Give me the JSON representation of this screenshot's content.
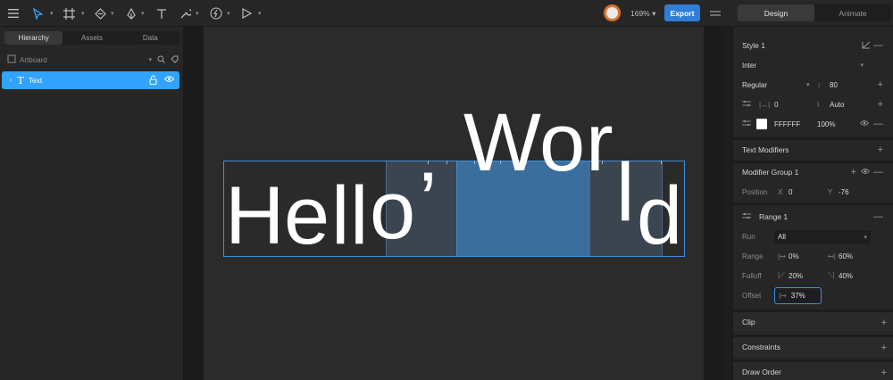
{
  "toolbar": {
    "zoom": "169%",
    "export_label": "Export",
    "mode_tabs": [
      "Design",
      "Animate"
    ]
  },
  "left_panel": {
    "tabs": [
      "Hierarchy",
      "Assets",
      "Data"
    ],
    "artboard_label": "Artboard",
    "layer_name": "Text"
  },
  "canvas": {
    "glyphs": {
      "H": "H",
      "e": "e",
      "l1": "l",
      "l2": "l",
      "o": "o",
      "comma": "’",
      "W": "W",
      "o2": "o",
      "r": "r",
      "l3": "l",
      "d": "d"
    }
  },
  "right_panel": {
    "style_name": "Style 1",
    "font_family": "Inter",
    "font_weight": "Regular",
    "font_size": "80",
    "letter_spacing": "0",
    "line_height": "Auto",
    "fill_hex": "FFFFFF",
    "fill_opacity": "100%",
    "text_modifiers": "Text Modifiers",
    "modifier_group": "Modifier Group 1",
    "position_label": "Position",
    "pos_x_label": "X",
    "pos_x": "0",
    "pos_y_label": "Y",
    "pos_y": "-76",
    "range_name": "Range 1",
    "run_label": "Run",
    "run_value": "All",
    "range_label": "Range",
    "range_start": "0%",
    "range_end": "60%",
    "falloff_label": "Falloff",
    "falloff_start": "20%",
    "falloff_end": "40%",
    "offset_label": "Offset",
    "offset_value": "37%",
    "sections": [
      "Clip",
      "Constraints",
      "Draw Order"
    ]
  },
  "colors": {
    "accent": "#32a3ff",
    "export": "#2f7ed8",
    "selection": "#3d8fdc"
  }
}
